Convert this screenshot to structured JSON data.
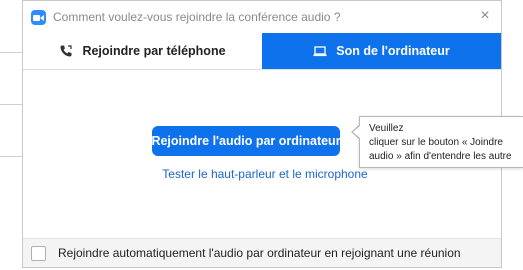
{
  "dialog": {
    "title": "Comment voulez-vous rejoindre la conférence audio ?",
    "close_symbol": "×",
    "app_icon": "zoom-camera-icon"
  },
  "tabs": [
    {
      "label": "Rejoindre par téléphone",
      "icon": "phone-icon",
      "active": false
    },
    {
      "label": "Son de l'ordinateur",
      "icon": "laptop-icon",
      "active": true
    }
  ],
  "main": {
    "join_button_label": "Rejoindre l'audio par ordinateur",
    "test_link_label": "Tester le haut-parleur et le microphone"
  },
  "footer": {
    "checkbox_checked": false,
    "checkbox_label": "Rejoindre automatiquement l'audio par ordinateur en rejoignant une réunion"
  },
  "tooltip": {
    "lines": [
      "Veuillez",
      "cliquer sur le bouton « Joindre",
      "audio » afin d'entendre les autre"
    ]
  },
  "colors": {
    "accent": "#0e72ed",
    "link": "#1a66c9",
    "title_text": "#8a8a8a"
  }
}
